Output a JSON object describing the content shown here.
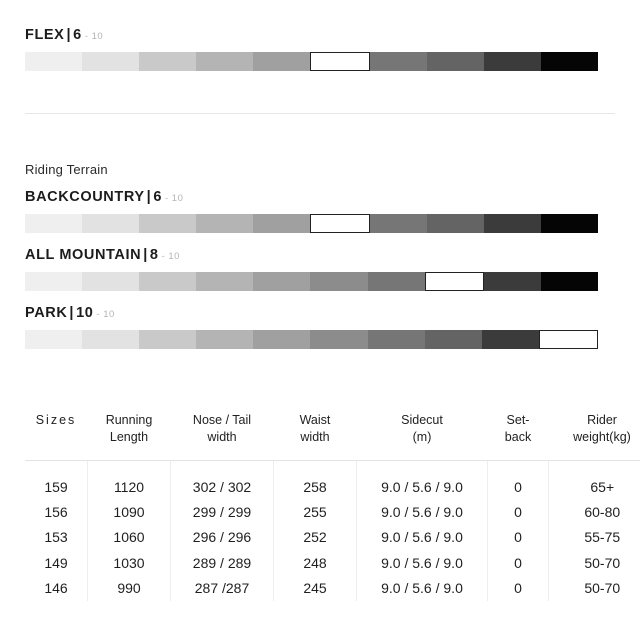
{
  "flex": {
    "label": "FLEX",
    "separator": "|",
    "value": "6",
    "max": "- 10",
    "rating": 6,
    "segments": 10
  },
  "terrain": {
    "section_title": "Riding Terrain",
    "items": [
      {
        "label": "BACKCOUNTRY",
        "separator": "|",
        "value": "6",
        "max": "- 10",
        "rating": 6,
        "segments": 10
      },
      {
        "label": "ALL MOUNTAIN",
        "separator": "|",
        "value": "8",
        "max": "- 10",
        "rating": 8,
        "segments": 10
      },
      {
        "label": "PARK",
        "separator": "|",
        "value": "10",
        "max": "- 10",
        "rating": 10,
        "segments": 10
      }
    ]
  },
  "scale_colors": [
    "#efefef",
    "#e2e2e2",
    "#c9c9c9",
    "#b4b4b4",
    "#a0a0a0",
    "#8c8c8c",
    "#767676",
    "#646464",
    "#3b3b3b",
    "#050505"
  ],
  "table": {
    "headers": [
      {
        "line1": "Sizes",
        "line2": ""
      },
      {
        "line1": "Running",
        "line2": "Length"
      },
      {
        "line1": "Nose / Tail",
        "line2": "width"
      },
      {
        "line1": "Waist",
        "line2": "width"
      },
      {
        "line1": "Sidecut",
        "line2": "(m)"
      },
      {
        "line1": "Set-",
        "line2": "back"
      },
      {
        "line1": "Rider",
        "line2": "weight(kg)"
      }
    ],
    "rows": [
      {
        "size": "159",
        "running_length": "1120",
        "nose_tail_width": "302 / 302",
        "waist_width": "258",
        "sidecut": "9.0 / 5.6 / 9.0",
        "setback": "0",
        "rider_weight": "65+"
      },
      {
        "size": "156",
        "running_length": "1090",
        "nose_tail_width": "299 / 299",
        "waist_width": "255",
        "sidecut": "9.0 / 5.6 / 9.0",
        "setback": "0",
        "rider_weight": "60-80"
      },
      {
        "size": "153",
        "running_length": "1060",
        "nose_tail_width": "296 / 296",
        "waist_width": "252",
        "sidecut": "9.0 / 5.6 / 9.0",
        "setback": "0",
        "rider_weight": "55-75"
      },
      {
        "size": "149",
        "running_length": "1030",
        "nose_tail_width": "289 / 289",
        "waist_width": "248",
        "sidecut": "9.0 / 5.6 / 9.0",
        "setback": "0",
        "rider_weight": "50-70"
      },
      {
        "size": "146",
        "running_length": "990",
        "nose_tail_width": "287 /287",
        "waist_width": "245",
        "sidecut": "9.0 / 5.6 / 9.0",
        "setback": "0",
        "rider_weight": "50-70"
      }
    ]
  }
}
